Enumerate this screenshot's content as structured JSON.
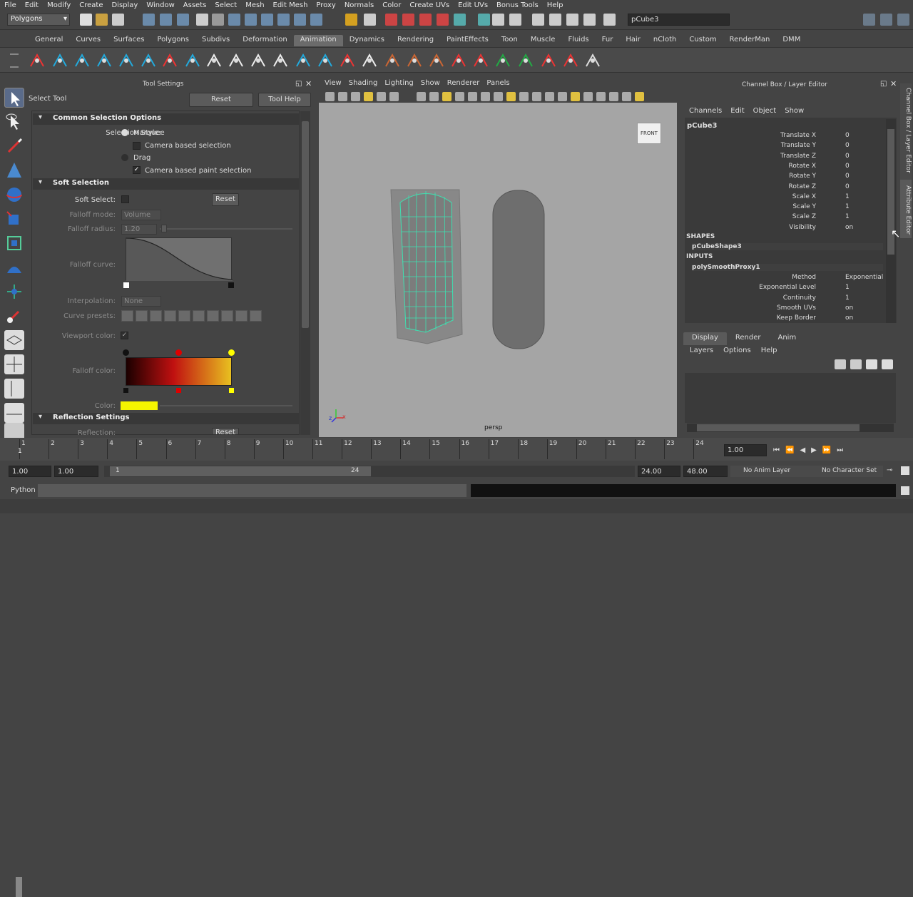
{
  "menubar": [
    "File",
    "Edit",
    "Modify",
    "Create",
    "Display",
    "Window",
    "Assets",
    "Select",
    "Mesh",
    "Edit Mesh",
    "Proxy",
    "Normals",
    "Color",
    "Create UVs",
    "Edit UVs",
    "Bonus Tools",
    "Help"
  ],
  "status": {
    "mode": "Polygons",
    "object": "pCube3"
  },
  "shelf_tabs": [
    "General",
    "Curves",
    "Surfaces",
    "Polygons",
    "Subdivs",
    "Deformation",
    "Animation",
    "Dynamics",
    "Rendering",
    "PaintEffects",
    "Toon",
    "Muscle",
    "Fluids",
    "Fur",
    "Hair",
    "nCloth",
    "Custom",
    "RenderMan",
    "DMM"
  ],
  "shelf_active": "Animation",
  "tool": {
    "panel_title": "Tool Settings",
    "name": "Select Tool",
    "reset": "Reset",
    "help": "Tool Help",
    "common_header": "Common Selection Options",
    "selection_style": "Selection Style:",
    "marquee": "Marquee",
    "camera_based": "Camera based selection",
    "drag": "Drag",
    "camera_paint": "Camera based paint selection",
    "soft_header": "Soft Selection",
    "soft_select": "Soft Select:",
    "falloff_mode": "Falloff mode:",
    "falloff_mode_val": "Volume",
    "falloff_radius": "Falloff radius:",
    "falloff_radius_val": "1.20",
    "falloff_curve": "Falloff curve:",
    "interpolation": "Interpolation:",
    "interp_val": "None",
    "curve_presets": "Curve presets:",
    "viewport_color": "Viewport color:",
    "falloff_color": "Falloff color:",
    "color": "Color:",
    "reflection_header": "Reflection Settings",
    "reflection": "Reflection:",
    "reflection_reset": "Reset"
  },
  "viewport": {
    "menu": [
      "View",
      "Shading",
      "Lighting",
      "Show",
      "Renderer",
      "Panels"
    ],
    "cube_label": "FRONT",
    "camera": "persp",
    "axis_x": "x",
    "axis_z": "z"
  },
  "channel": {
    "title": "Channel Box / Layer Editor",
    "menu": [
      "Channels",
      "Edit",
      "Object",
      "Show"
    ],
    "object": "pCube3",
    "attrs": [
      {
        "k": "Translate X",
        "v": "0"
      },
      {
        "k": "Translate Y",
        "v": "0"
      },
      {
        "k": "Translate Z",
        "v": "0"
      },
      {
        "k": "Rotate X",
        "v": "0"
      },
      {
        "k": "Rotate Y",
        "v": "0"
      },
      {
        "k": "Rotate Z",
        "v": "0"
      },
      {
        "k": "Scale X",
        "v": "1"
      },
      {
        "k": "Scale Y",
        "v": "1"
      },
      {
        "k": "Scale Z",
        "v": "1"
      },
      {
        "k": "Visibility",
        "v": "on"
      }
    ],
    "shapes_label": "SHAPES",
    "shape": "pCubeShape3",
    "inputs_label": "INPUTS",
    "input": "polySmoothProxy1",
    "inputs": [
      {
        "k": "Method",
        "v": "Exponential"
      },
      {
        "k": "Exponential Level",
        "v": "1"
      },
      {
        "k": "Continuity",
        "v": "1"
      },
      {
        "k": "Smooth UVs",
        "v": "on"
      },
      {
        "k": "Keep Border",
        "v": "on"
      }
    ],
    "side_tab1": "Channel Box / Layer Editor",
    "side_tab2": "Attribute Editor"
  },
  "layers": {
    "tabs": [
      "Display",
      "Render",
      "Anim"
    ],
    "menu": [
      "Layers",
      "Options",
      "Help"
    ]
  },
  "timeline": {
    "ticks": [
      "1",
      "2",
      "3",
      "4",
      "5",
      "6",
      "7",
      "8",
      "9",
      "10",
      "11",
      "12",
      "13",
      "14",
      "15",
      "16",
      "17",
      "18",
      "19",
      "20",
      "21",
      "22",
      "23",
      "24"
    ],
    "current": "1",
    "time_field": "1.00"
  },
  "range": {
    "start": "1.00",
    "start2": "1.00",
    "range_start": "1",
    "range_end": "24",
    "end": "24.00",
    "end2": "48.00",
    "anim_layer": "No Anim Layer",
    "char_set": "No Character Set"
  },
  "script": {
    "lang": "Python"
  }
}
